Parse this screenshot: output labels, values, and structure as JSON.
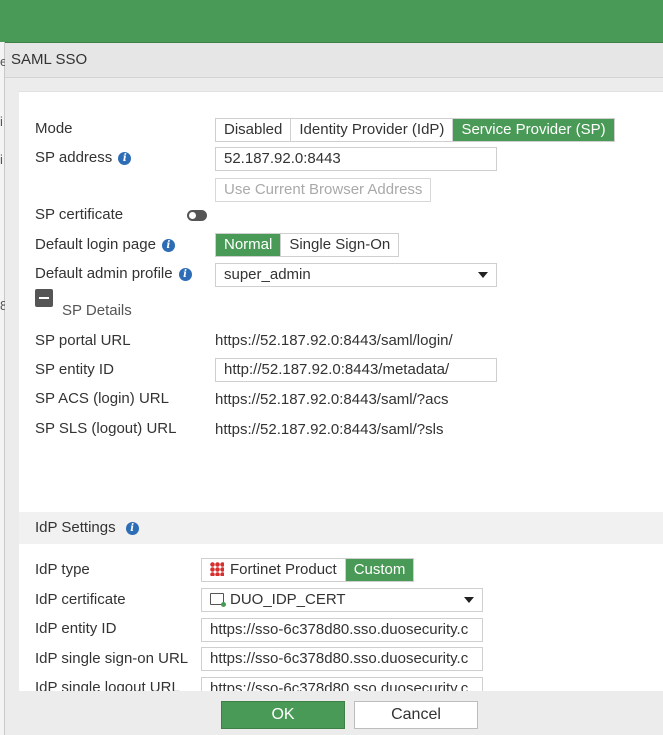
{
  "dialog": {
    "title": "SAML SSO"
  },
  "left_edge_chars": [
    "e",
    "i",
    "i",
    "8"
  ],
  "mode": {
    "label": "Mode",
    "options": [
      "Disabled",
      "Identity Provider (IdP)",
      "Service Provider (SP)"
    ],
    "selected": "Service Provider (SP)"
  },
  "sp_address": {
    "label": "SP address",
    "value": "52.187.92.0:8443",
    "use_current_label": "Use Current Browser Address"
  },
  "sp_certificate": {
    "label": "SP certificate",
    "enabled": false
  },
  "default_login_page": {
    "label": "Default login page",
    "options": [
      "Normal",
      "Single Sign-On"
    ],
    "selected": "Normal"
  },
  "default_admin_profile": {
    "label": "Default admin profile",
    "value": "super_admin"
  },
  "sp_details": {
    "label": "SP Details",
    "portal_url": {
      "label": "SP portal URL",
      "value": "https://52.187.92.0:8443/saml/login/"
    },
    "entity_id": {
      "label": "SP entity ID",
      "value": "http://52.187.92.0:8443/metadata/"
    },
    "acs_url": {
      "label": "SP ACS (login) URL",
      "value": "https://52.187.92.0:8443/saml/?acs"
    },
    "sls_url": {
      "label": "SP SLS (logout) URL",
      "value": "https://52.187.92.0:8443/saml/?sls"
    }
  },
  "idp_settings": {
    "label": "IdP Settings",
    "type": {
      "label": "IdP type",
      "options": [
        "Fortinet Product",
        "Custom"
      ],
      "selected": "Custom"
    },
    "certificate": {
      "label": "IdP certificate",
      "value": "DUO_IDP_CERT"
    },
    "entity_id": {
      "label": "IdP entity ID",
      "value": "https://sso-6c378d80.sso.duosecurity.c"
    },
    "sso_url": {
      "label": "IdP single sign-on URL",
      "value": "https://sso-6c378d80.sso.duosecurity.c"
    },
    "slo_url": {
      "label": "IdP single logout URL",
      "value": "https://sso-6c378d80.sso.duosecurity.c"
    }
  },
  "footer": {
    "ok_label": "OK",
    "cancel_label": "Cancel"
  },
  "colors": {
    "accent": "#4a9a57",
    "info_icon": "#2d6db5"
  },
  "icons": {
    "info": "info-icon",
    "fortinet": "fortinet-logo-icon",
    "certificate": "certificate-icon",
    "collapse": "collapse-minus-icon",
    "dropdown": "chevron-down-icon"
  }
}
